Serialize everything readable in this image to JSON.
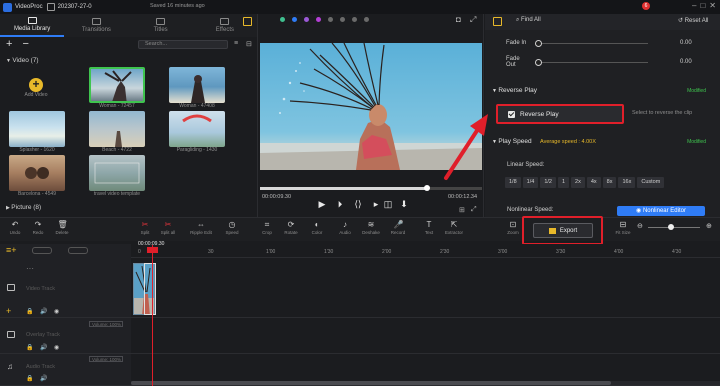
{
  "app": {
    "title": "VideoProc",
    "project": "202307-27-0",
    "saved_text": "Saved 16 minutes ago",
    "notif_count": "6"
  },
  "library_tabs": [
    {
      "label": "Media Library",
      "active": true,
      "icon": "media-library-icon"
    },
    {
      "label": "Transitions",
      "active": false,
      "icon": "transitions-icon"
    },
    {
      "label": "Titles",
      "active": false,
      "icon": "titles-icon"
    },
    {
      "label": "Effects",
      "active": false,
      "icon": "effects-icon"
    }
  ],
  "search": {
    "placeholder": "Search..."
  },
  "sections": {
    "video": "Video (7)",
    "picture": "Picture (8)"
  },
  "add_video_label": "Add Video",
  "media": [
    {
      "name": "Woman - 72457"
    },
    {
      "name": "Woman - 47408"
    },
    {
      "name": "Splasher - 1620"
    },
    {
      "name": "Beach - 4722"
    },
    {
      "name": "Paragliding - 1430"
    },
    {
      "name": "Barcelona - 4549"
    },
    {
      "name": "travel video template"
    }
  ],
  "preview": {
    "time_current": "00:00:09.30",
    "time_total": "00:00:12.34",
    "progress": 0.76
  },
  "right_panel": {
    "find_all": "Find All",
    "reset_all": "Reset All",
    "fade_in_label": "Fade In",
    "fade_in_value": "0.00",
    "fade_out_label": "Fade Out",
    "fade_out_value": "0.00",
    "reverse_section": "Reverse Play",
    "reverse_modified": "Modified",
    "reverse_checkbox": "Reverse Play",
    "reverse_hint": "Select to reverse the clip",
    "speed_section": "Play Speed",
    "speed_avg": "Average speed : 4.00X",
    "speed_modified": "Modified",
    "linear_label": "Linear Speed:",
    "speeds": [
      "1/8",
      "1/4",
      "1/2",
      "1",
      "2x",
      "4x",
      "8x",
      "16x",
      "Custom"
    ],
    "nonlinear_label": "Nonlinear Speed:",
    "nonlinear_btn": "Nonlinear Editor"
  },
  "toolbar": [
    {
      "label": "Undo",
      "glyph": "↶"
    },
    {
      "label": "Redo",
      "glyph": "↷"
    },
    {
      "label": "Delete",
      "glyph": "🗑"
    },
    {
      "label": "Split",
      "glyph": "✂",
      "red": true
    },
    {
      "label": "Split all",
      "glyph": "✂",
      "red": true
    },
    {
      "label": "Ripple Edit",
      "glyph": "⇔"
    },
    {
      "label": "Speed",
      "glyph": "◷"
    },
    {
      "label": "Crop",
      "glyph": "⌗"
    },
    {
      "label": "Rotate",
      "glyph": "⟳"
    },
    {
      "label": "Color",
      "glyph": "◐"
    },
    {
      "label": "Audio",
      "glyph": "♪"
    },
    {
      "label": "Deshake",
      "glyph": "≋"
    },
    {
      "label": "Record",
      "glyph": "🎤"
    },
    {
      "label": "Text",
      "glyph": "T"
    },
    {
      "label": "Extractor",
      "glyph": "⇱"
    }
  ],
  "export_label": "Export",
  "subtitles_label": "Zoom",
  "fit_size_label": "Fit Size",
  "timeline": {
    "playhead": "00:00:09.30",
    "ticks": [
      "0",
      "30",
      "1'00",
      "1'30",
      "2'00",
      "2'30",
      "3'00",
      "3'30",
      "4'00",
      "4'30"
    ],
    "tracks": [
      {
        "name": "Video Track"
      },
      {
        "name": "Overlay Track",
        "volume": "Volume: 100%"
      },
      {
        "name": "Audio Track",
        "volume": "Volume: 100%"
      }
    ],
    "music_label": "Media Clips"
  },
  "colors": {
    "accent": "#2f7cf6",
    "highlight": "#e01f2a",
    "gold": "#e8b92a",
    "modified": "#3fc44f"
  }
}
